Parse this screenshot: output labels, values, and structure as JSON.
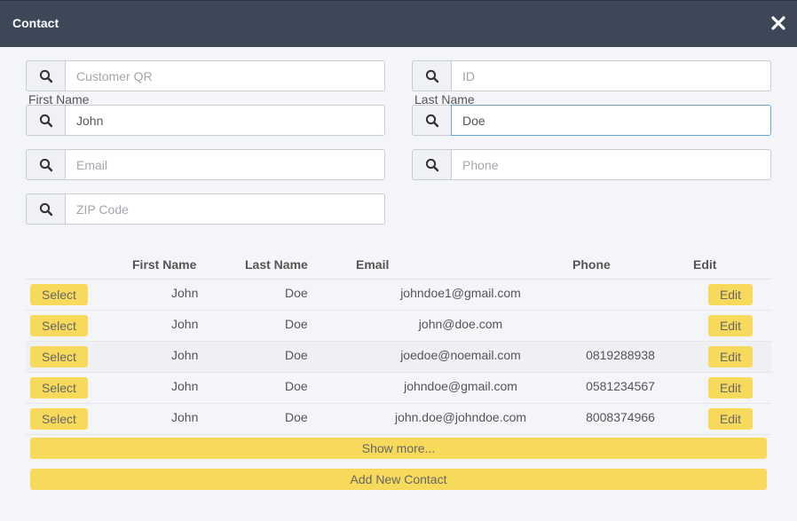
{
  "window": {
    "title": "Contact"
  },
  "fields": {
    "customer_qr": {
      "placeholder": "Customer QR",
      "value": ""
    },
    "id": {
      "placeholder": "ID",
      "value": ""
    },
    "first_name": {
      "label": "First Name",
      "placeholder": "",
      "value": "John"
    },
    "last_name": {
      "label": "Last Name",
      "placeholder": "",
      "value": "Doe"
    },
    "email": {
      "placeholder": "Email",
      "value": ""
    },
    "phone": {
      "placeholder": "Phone",
      "value": ""
    },
    "zip": {
      "placeholder": "ZIP Code",
      "value": ""
    }
  },
  "table": {
    "headers": [
      "First Name",
      "Last Name",
      "Email",
      "Phone",
      "Edit"
    ],
    "select_label": "Select",
    "edit_label": "Edit",
    "rows": [
      {
        "first": "John",
        "last": "Doe",
        "email": "johndoe1@gmail.com",
        "phone": ""
      },
      {
        "first": "John",
        "last": "Doe",
        "email": "john@doe.com",
        "phone": ""
      },
      {
        "first": "John",
        "last": "Doe",
        "email": "joedoe@noemail.com",
        "phone": "0819288938"
      },
      {
        "first": "John",
        "last": "Doe",
        "email": "johndoe@gmail.com",
        "phone": "0581234567"
      },
      {
        "first": "John",
        "last": "Doe",
        "email": "john.doe@johndoe.com",
        "phone": "8008374966"
      }
    ]
  },
  "actions": {
    "show_more": "Show more...",
    "add_new": "Add New Contact"
  },
  "colors": {
    "titlebar": "#3d4757",
    "button": "#f7d95c",
    "background": "#f4f5f9"
  },
  "icons": {
    "close": "close-icon",
    "search": "search-icon"
  }
}
